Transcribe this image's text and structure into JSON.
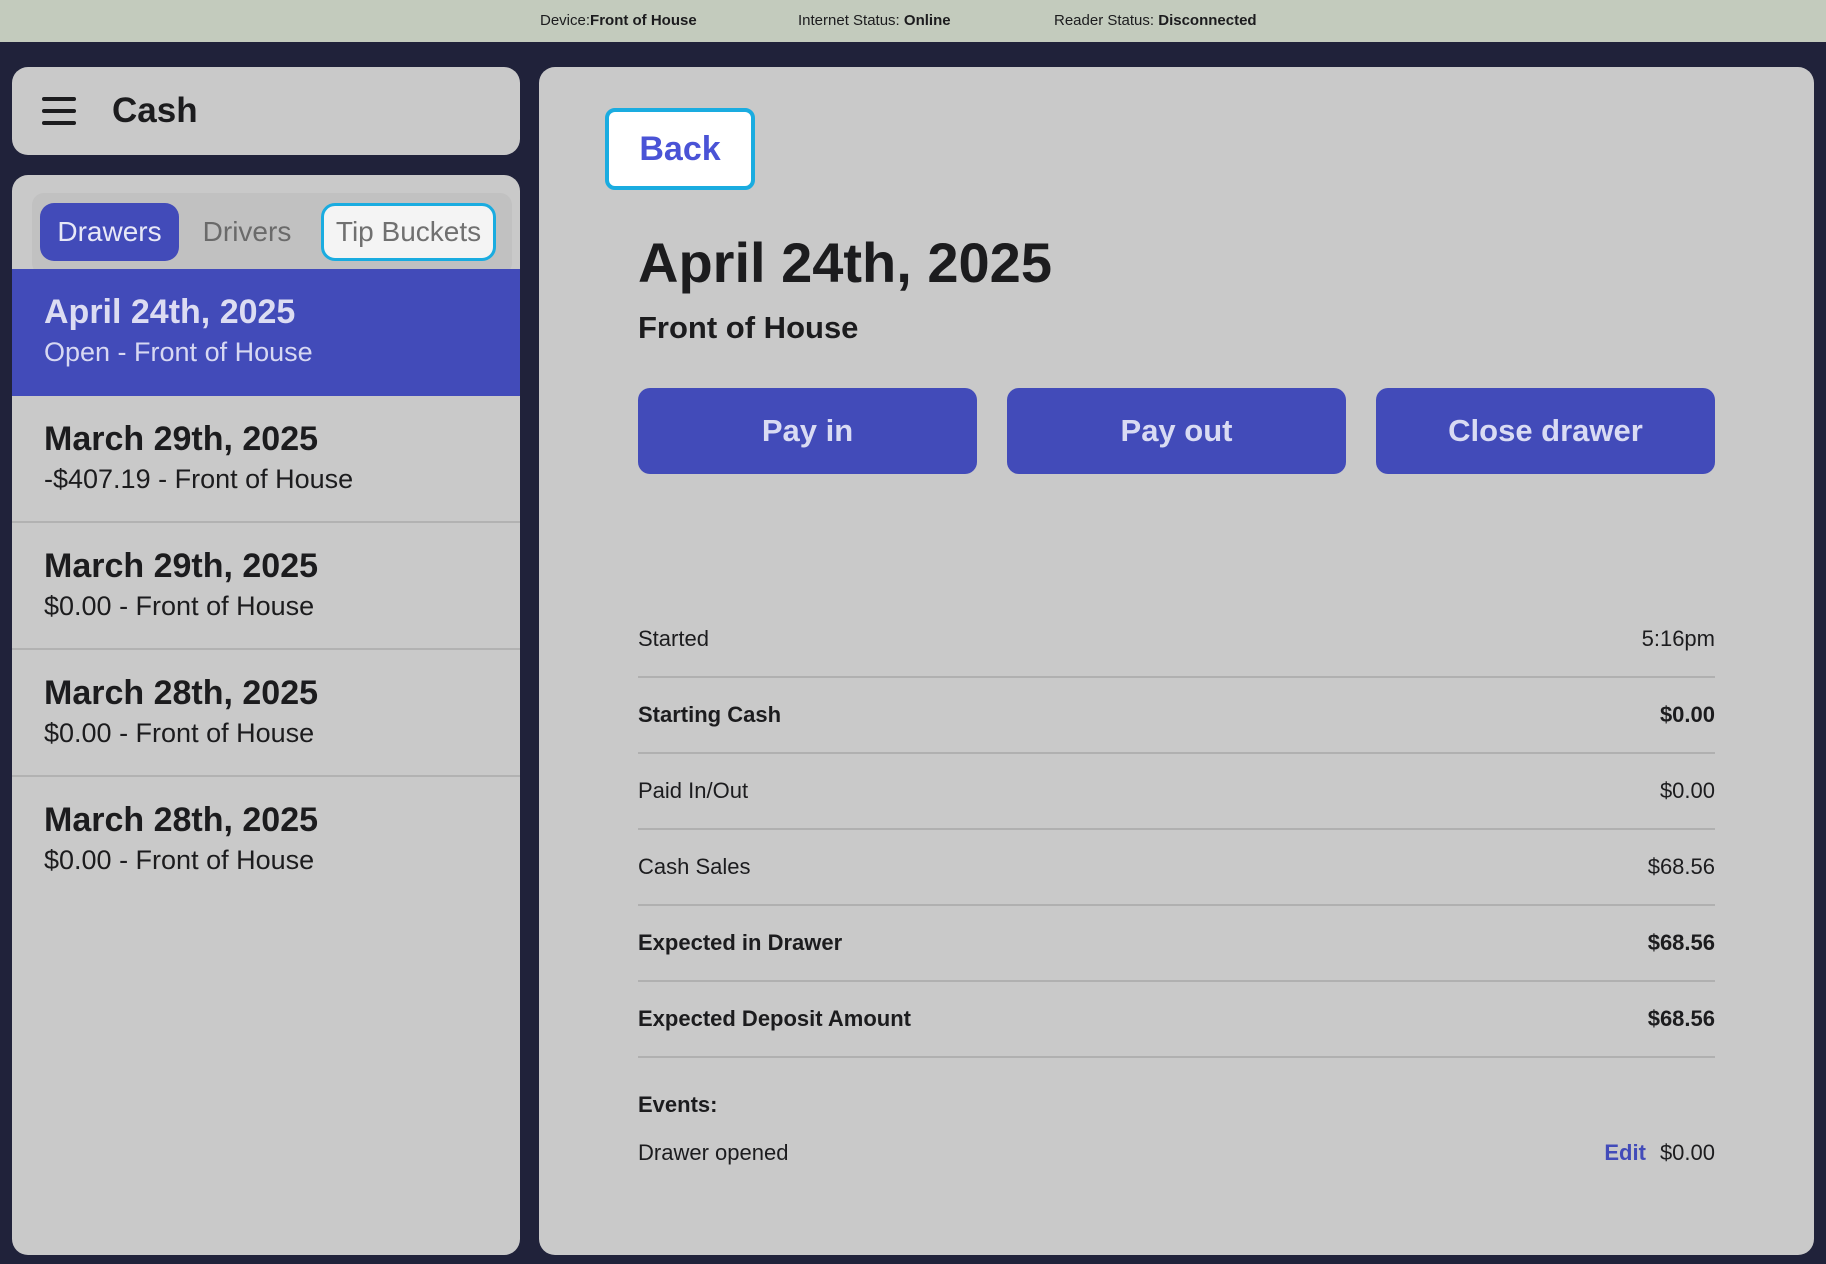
{
  "status_bar": {
    "device_label": "Device:",
    "device_value": "Front of House",
    "internet_label": "Internet Status: ",
    "internet_value": "Online",
    "reader_label": "Reader Status: ",
    "reader_value": "Disconnected"
  },
  "header": {
    "title": "Cash"
  },
  "tabs": [
    {
      "label": "Drawers",
      "selected": true
    },
    {
      "label": "Drivers",
      "selected": false
    },
    {
      "label": "Tip Buckets",
      "selected": false
    }
  ],
  "drawers": [
    {
      "title": "April 24th, 2025",
      "subtitle": "Open - Front of House",
      "active": true
    },
    {
      "title": "March 29th, 2025",
      "subtitle": "-$407.19 - Front of House",
      "active": false
    },
    {
      "title": "March 29th, 2025",
      "subtitle": "$0.00 - Front of House",
      "active": false
    },
    {
      "title": "March 28th, 2025",
      "subtitle": "$0.00 - Front of House",
      "active": false
    },
    {
      "title": "March 28th, 2025",
      "subtitle": "$0.00 - Front of House",
      "active": false
    }
  ],
  "detail": {
    "back_label": "Back",
    "title": "April 24th, 2025",
    "subtitle": "Front of House",
    "actions": {
      "pay_in": "Pay in",
      "pay_out": "Pay out",
      "close_drawer": "Close drawer"
    },
    "stats": [
      {
        "label": "Started",
        "value": "5:16pm",
        "bold": false
      },
      {
        "label": "Starting Cash",
        "value": "$0.00",
        "bold": true
      },
      {
        "label": "Paid In/Out",
        "value": "$0.00",
        "bold": false
      },
      {
        "label": "Cash Sales",
        "value": "$68.56",
        "bold": false
      },
      {
        "label": "Expected in Drawer",
        "value": "$68.56",
        "bold": true
      },
      {
        "label": "Expected Deposit Amount",
        "value": "$68.56",
        "bold": true
      }
    ],
    "events_label": "Events:",
    "events": [
      {
        "label": "Drawer opened",
        "edit_label": "Edit",
        "amount": "$0.00"
      }
    ]
  },
  "colors": {
    "accent": "#424bb9",
    "focus_ring": "#1aace0",
    "status_bar": "#c3cbbd",
    "background": "#20223a",
    "panel": "#c9c9c9"
  }
}
